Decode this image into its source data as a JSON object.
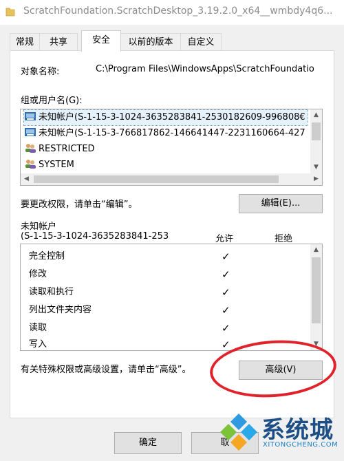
{
  "window": {
    "title": "ScratchFoundation.ScratchDesktop_3.19.2.0_x64__wmbdy4q6..."
  },
  "tabs": [
    {
      "label": "常规"
    },
    {
      "label": "共享"
    },
    {
      "label": "安全"
    },
    {
      "label": "以前的版本"
    },
    {
      "label": "自定义"
    }
  ],
  "object": {
    "label": "对象名称:",
    "value": "C:\\Program Files\\WindowsApps\\ScratchFoundatio"
  },
  "groups": {
    "label": "组或用户名(G):",
    "items": [
      {
        "name": "未知帐户(S-1-15-3-1024-3635283841-2530182609-996808€",
        "icon": "unknown-account-icon"
      },
      {
        "name": "未知帐户(S-1-15-3-766817862-146641447-2231160664-427",
        "icon": "unknown-account-icon"
      },
      {
        "name": "RESTRICTED",
        "icon": "users-group-icon"
      },
      {
        "name": "SYSTEM",
        "icon": "users-group-icon"
      }
    ]
  },
  "change_hint": "要更改权限，请单击“编辑”。",
  "edit_button": "编辑(E)...",
  "permissions": {
    "for_line1": "未知帐户",
    "for_line2": "(S-1-15-3-1024-3635283841-253",
    "allow": "允许",
    "deny": "拒绝",
    "rows": [
      {
        "name": "完全控制",
        "allow": "✓",
        "deny": ""
      },
      {
        "name": "修改",
        "allow": "✓",
        "deny": ""
      },
      {
        "name": "读取和执行",
        "allow": "✓",
        "deny": ""
      },
      {
        "name": "列出文件夹内容",
        "allow": "✓",
        "deny": ""
      },
      {
        "name": "读取",
        "allow": "✓",
        "deny": ""
      },
      {
        "name": "写入",
        "allow": "✓",
        "deny": ""
      }
    ]
  },
  "advanced_hint": "有关特殊权限或高级设置，请单击“高级”。",
  "advanced_button": "高级(V)",
  "buttons": {
    "ok": "确定",
    "cancel": "取"
  },
  "watermark": {
    "text": "系统城",
    "sub": "XITONGCHENG.COM"
  },
  "colors": {
    "highlight_circle": "#e0222a",
    "selection": "#e5f1fb"
  }
}
